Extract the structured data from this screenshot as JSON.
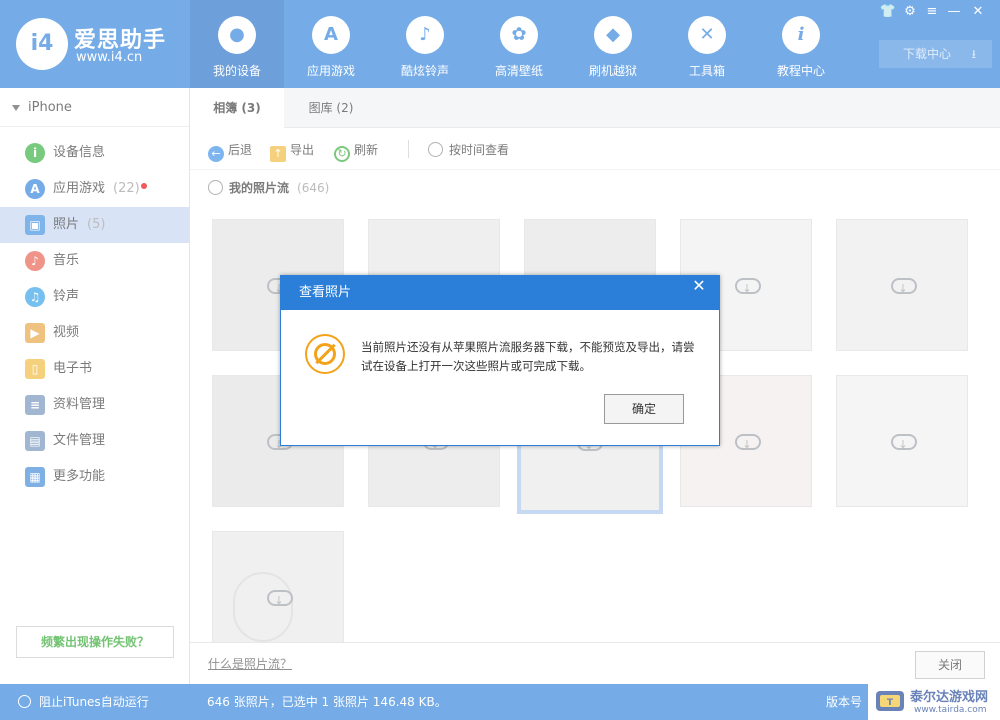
{
  "app": {
    "logo_mark": "i4",
    "logo_name": "爱思助手",
    "logo_url": "www.i4.cn"
  },
  "nav": [
    {
      "label": "我的设备",
      "icon": "apple-icon",
      "glyph": ""
    },
    {
      "label": "应用游戏",
      "icon": "app-store-icon",
      "glyph": "A"
    },
    {
      "label": "酷炫铃声",
      "icon": "bell-icon",
      "glyph": "♪"
    },
    {
      "label": "高清壁纸",
      "icon": "flower-icon",
      "glyph": "✿"
    },
    {
      "label": "刷机越狱",
      "icon": "dropbox-icon",
      "glyph": "◆"
    },
    {
      "label": "工具箱",
      "icon": "tools-icon",
      "glyph": "✕"
    },
    {
      "label": "教程中心",
      "icon": "info-icon",
      "glyph": "i"
    }
  ],
  "window_controls": {
    "shirt": "👕",
    "gear": "⚙",
    "menu": "≡",
    "minimize": "—",
    "close": "✕"
  },
  "download_center": "下载中心",
  "sidebar": {
    "device": "iPhone",
    "items": [
      {
        "label": "设备信息",
        "count": "",
        "icon": "info-icon",
        "color": "#2fae3a",
        "glyph": "i"
      },
      {
        "label": "应用游戏",
        "count": "(22)",
        "icon": "app-store-icon",
        "color": "#2b7fd9",
        "glyph": "A"
      },
      {
        "label": "照片",
        "count": "(5)",
        "icon": "photo-icon",
        "color": "#3b8de0",
        "glyph": "▣"
      },
      {
        "label": "音乐",
        "count": "",
        "icon": "music-icon",
        "color": "#e85b4a",
        "glyph": "♪"
      },
      {
        "label": "铃声",
        "count": "",
        "icon": "bell-icon",
        "color": "#2b9ee6",
        "glyph": "♫"
      },
      {
        "label": "视频",
        "count": "",
        "icon": "film-icon",
        "color": "#e6a23c",
        "glyph": "▶"
      },
      {
        "label": "电子书",
        "count": "",
        "icon": "book-icon",
        "color": "#f0b83a",
        "glyph": "▯"
      },
      {
        "label": "资料管理",
        "count": "",
        "icon": "contacts-icon",
        "color": "#6d8fb8",
        "glyph": "≡"
      },
      {
        "label": "文件管理",
        "count": "",
        "icon": "file-icon",
        "color": "#6d8fb8",
        "glyph": "▤"
      },
      {
        "label": "更多功能",
        "count": "",
        "icon": "grid-icon",
        "color": "#3a86d6",
        "glyph": "▦"
      }
    ],
    "help_button": "频繁出现操作失败？"
  },
  "tabs": [
    {
      "label": "相簿 (3)"
    },
    {
      "label": "图库 (2)"
    }
  ],
  "toolbar": {
    "back": "后退",
    "export": "导出",
    "refresh": "刷新",
    "by_time": "按时间查看"
  },
  "stream": {
    "name": "我的照片流",
    "count": "(646)"
  },
  "bottom": {
    "link": "什么是照片流？",
    "close": "关闭"
  },
  "status": {
    "itunes": "阻止iTunes自动运行",
    "summary": "646 张照片，已选中 1 张照片 146.48 KB。",
    "version": "版本号"
  },
  "watermark": {
    "title": "泰尔达游戏网",
    "url": "www.tairda.com"
  },
  "dialog": {
    "title": "查看照片",
    "close": "✕",
    "message": "当前照片还没有从苹果照片流服务器下载，不能预览及导出，请尝试在设备上打开一次这些照片或可完成下载。",
    "ok": "确定"
  }
}
